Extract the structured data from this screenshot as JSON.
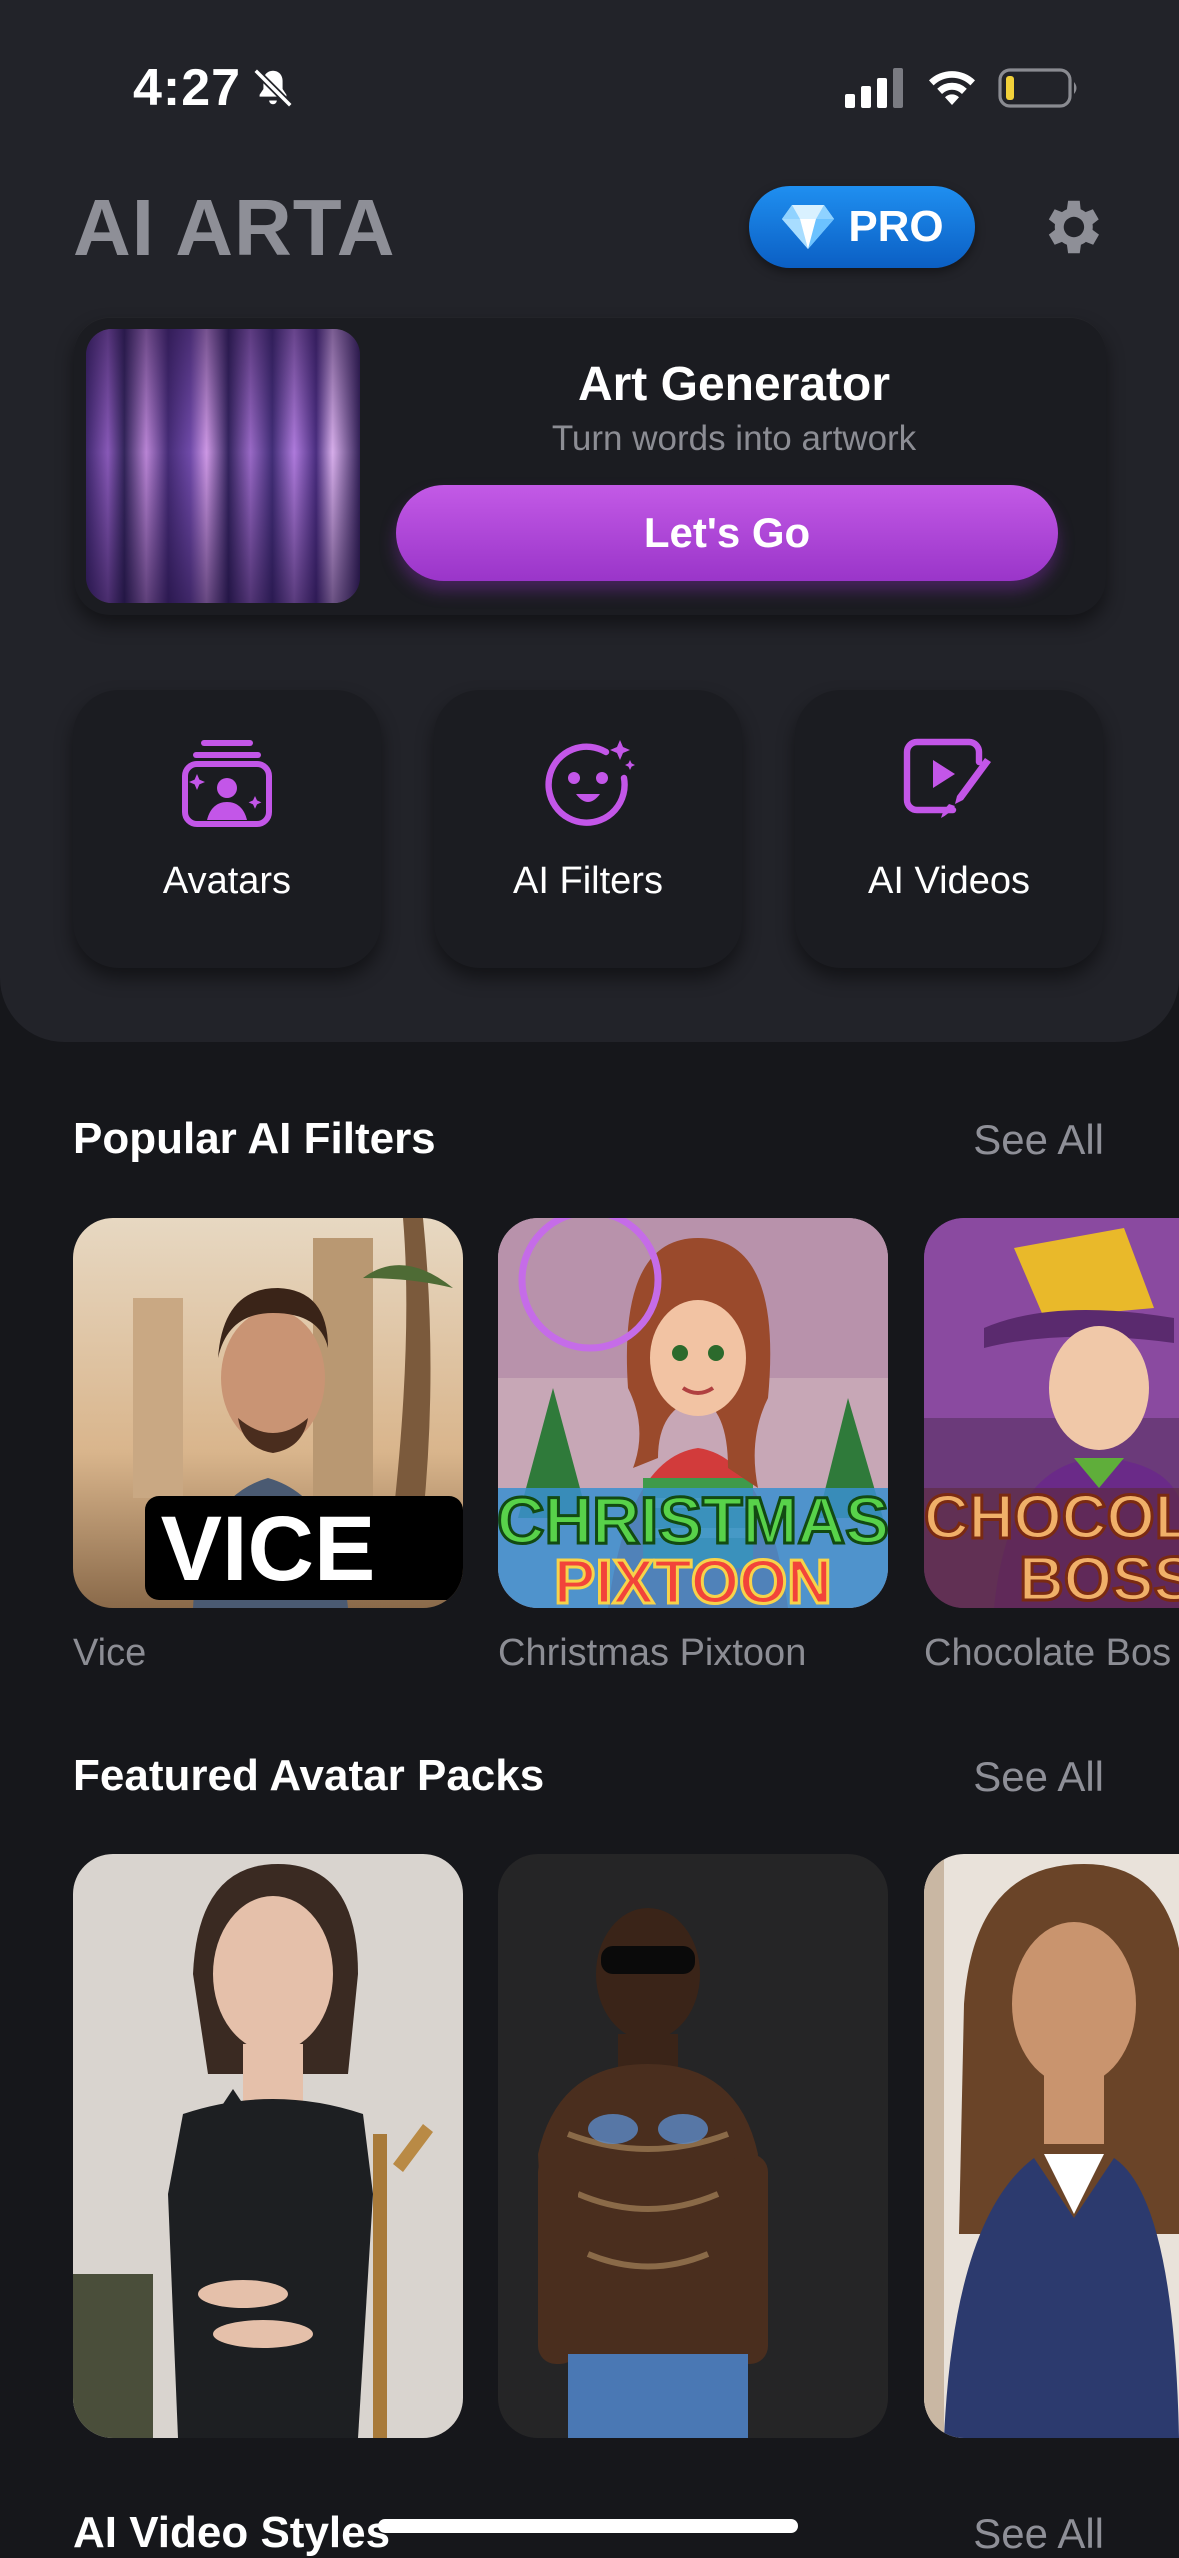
{
  "status_bar": {
    "time": "4:27"
  },
  "header": {
    "title": "AI ARTA",
    "pro_label": "PRO"
  },
  "generator": {
    "title": "Art Generator",
    "subtitle": "Turn words into artwork",
    "cta": "Let's Go"
  },
  "tiles": [
    {
      "label": "Avatars",
      "icon": "avatars-icon"
    },
    {
      "label": "AI Filters",
      "icon": "ai-filters-icon"
    },
    {
      "label": "AI Videos",
      "icon": "ai-videos-icon"
    }
  ],
  "popular_filters": {
    "title": "Popular AI Filters",
    "see_all": "See All",
    "items": [
      {
        "caption": "Vice",
        "overlay": "VICE"
      },
      {
        "caption": "Christmas Pixtoon",
        "overlay_line1": "CHRISTMAS",
        "overlay_line2": "PIXTOON"
      },
      {
        "caption": "Chocolate Bos",
        "overlay_line1": "CHOCOL",
        "overlay_line2": "BOSS"
      }
    ]
  },
  "avatar_packs": {
    "title": "Featured Avatar Packs",
    "see_all": "See All"
  },
  "video_styles": {
    "title": "AI Video Styles",
    "see_all": "See All"
  },
  "colors": {
    "accent": "#b44ddd",
    "pro_blue": "#1476df",
    "background": "#16171b",
    "panel": "#222329"
  }
}
